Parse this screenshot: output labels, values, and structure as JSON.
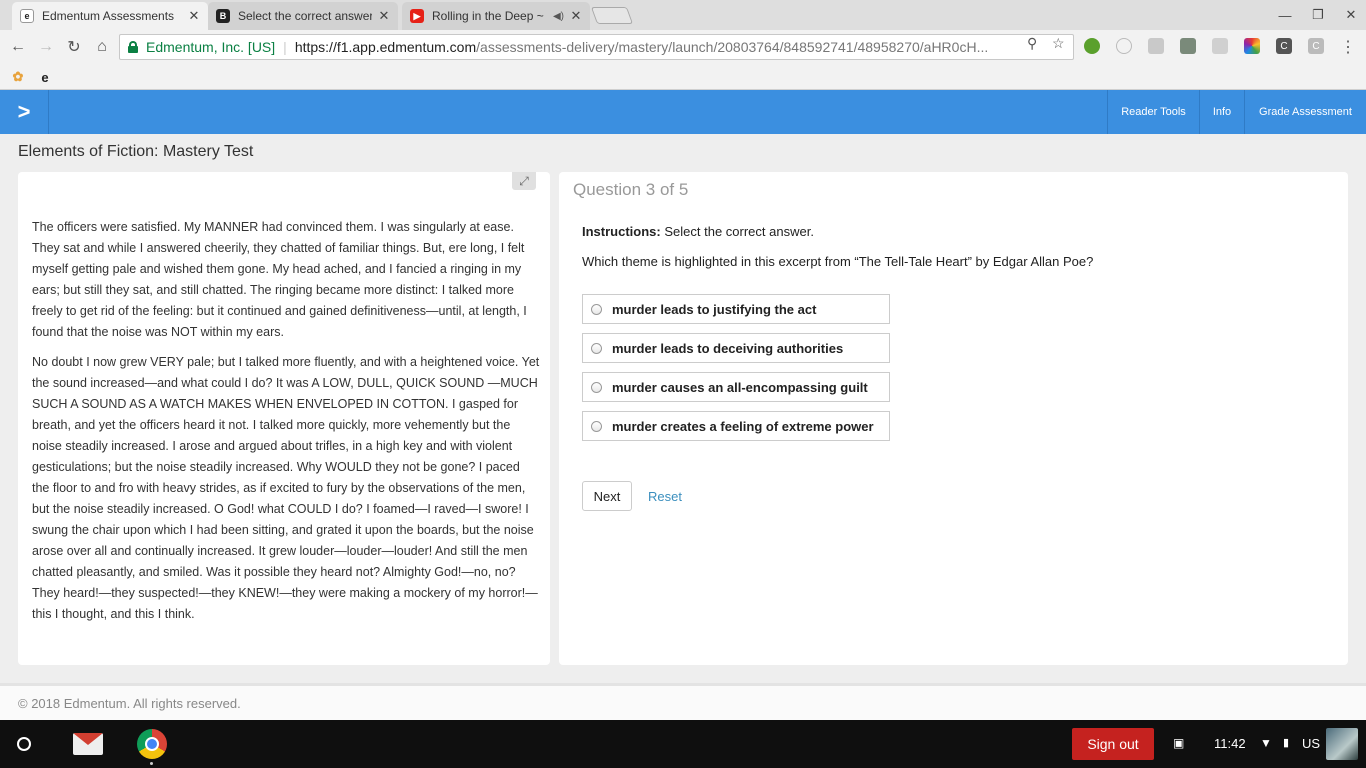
{
  "browser": {
    "tabs": [
      {
        "title": "Edmentum Assessments",
        "active": true,
        "favicon": "edmentum-favicon"
      },
      {
        "title": "Select the correct answer",
        "active": false,
        "favicon": "brainly-favicon"
      },
      {
        "title": "Rolling in the Deep ~",
        "active": false,
        "favicon": "youtube-favicon",
        "audio": true
      }
    ],
    "address_bar": {
      "site_identity": "Edmentum, Inc. [US]",
      "url_host": "https://f1.app.edmentum.com",
      "url_path": "/assessments-delivery/mastery/launch/20803764/848592741/48958270/aHR0cH..."
    },
    "bookmarks": [
      "photos-bookmark",
      "edmentum-bookmark"
    ]
  },
  "app": {
    "header_buttons": [
      "Reader Tools",
      "Info",
      "Grade Assessment"
    ],
    "page_title": "Elements of Fiction: Mastery Test",
    "passage": [
      "The officers were satisfied. My MANNER had convinced them. I was singularly at ease. They sat and while I answered cheerily, they chatted of familiar things. But, ere long, I felt myself getting pale and wished them gone. My head ached, and I fancied a ringing in my ears; but still they sat, and still chatted. The ringing became more distinct: I talked more freely to get rid of the feeling: but it continued and gained definitiveness—until, at length, I found that the noise was NOT within my ears.",
      "No doubt I now grew VERY pale; but I talked more fluently, and with a heightened voice. Yet the sound increased—and what could I do? It was A LOW, DULL, QUICK SOUND —MUCH SUCH A SOUND AS A WATCH MAKES WHEN ENVELOPED IN COTTON. I gasped for breath, and yet the officers heard it not. I talked more quickly, more vehemently but the noise steadily increased. I arose and argued about trifles, in a high key and with violent gesticulations; but the noise steadily increased. Why WOULD they not be gone? I paced the floor to and fro with heavy strides, as if excited to fury by the observations of the men, but the noise steadily increased. O God! what COULD I do? I foamed—I raved—I swore! I swung the chair upon which I had been sitting, and grated it upon the boards, but the noise arose over all and continually increased. It grew louder—louder—louder! And still the men chatted pleasantly, and smiled. Was it possible they heard not? Almighty God!—no, no? They heard!—they suspected!—they KNEW!—they were making a mockery of my horror!—this I thought, and this I think."
    ],
    "question": {
      "counter": "Question 3 of 5",
      "instructions_label": "Instructions:",
      "instructions_text": "Select the correct answer.",
      "prompt": "Which theme is highlighted in this excerpt from “The Tell-Tale Heart” by Edgar Allan Poe?",
      "options": [
        "murder leads to justifying the act",
        "murder leads to deceiving authorities",
        "murder causes an all-encompassing guilt",
        "murder creates a feeling of extreme power"
      ],
      "next_label": "Next",
      "reset_label": "Reset"
    },
    "footer": "© 2018 Edmentum. All rights reserved."
  },
  "os_shelf": {
    "signout_label": "Sign out",
    "time": "11:42",
    "keyboard_layout": "US"
  },
  "colors": {
    "header_blue": "#3b8fe0",
    "secure_green": "#0b8043",
    "signout_red": "#c5221f",
    "link_blue": "#3b8fbe"
  }
}
